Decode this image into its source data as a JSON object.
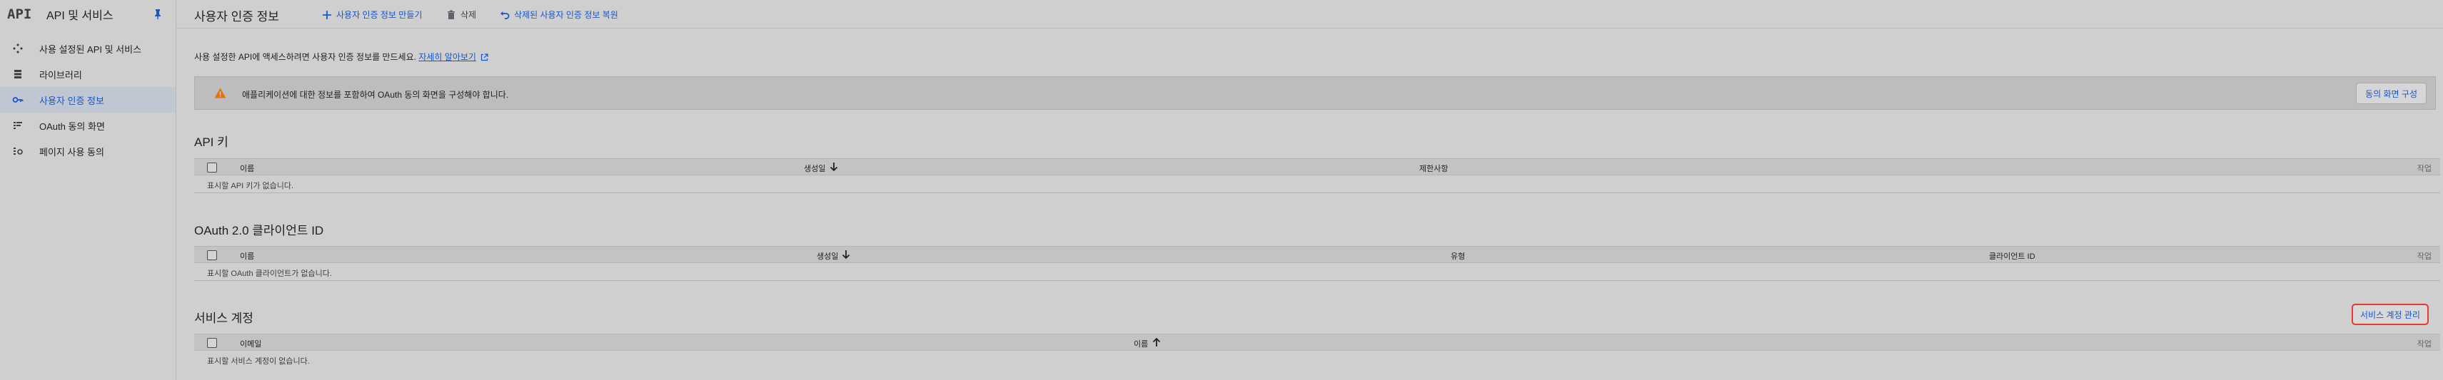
{
  "sidebar": {
    "logo": "API",
    "title": "API 및 서비스",
    "items": [
      {
        "label": "사용 설정된 API 및 서비스",
        "active": false
      },
      {
        "label": "라이브러리",
        "active": false
      },
      {
        "label": "사용자 인증 정보",
        "active": true
      },
      {
        "label": "OAuth 동의 화면",
        "active": false
      },
      {
        "label": "페이지 사용 동의",
        "active": false
      }
    ]
  },
  "header": {
    "title": "사용자 인증 정보",
    "create_label": "사용자 인증 정보 만들기",
    "delete_label": "삭제",
    "restore_label": "삭제된 사용자 인증 정보 복원"
  },
  "intro": {
    "text": "사용 설정한 API에 액세스하려면 사용자 인증 정보를 만드세요.",
    "link": "자세히 알아보기"
  },
  "banner": {
    "text": "애플리케이션에 대한 정보를 포함하여 OAuth 동의 화면을 구성해야 합니다.",
    "button": "동의 화면 구성"
  },
  "api_keys": {
    "title": "API 키",
    "columns": [
      "이름",
      "생성일",
      "제한사항",
      "작업"
    ],
    "empty": "표시할 API 키가 없습니다."
  },
  "oauth": {
    "title": "OAuth 2.0 클라이언트 ID",
    "columns": [
      "이름",
      "생성일",
      "유형",
      "클라이언트 ID",
      "작업"
    ],
    "empty": "표시할 OAuth 클라이언트가 없습니다."
  },
  "service_accounts": {
    "title": "서비스 계정",
    "manage_button": "서비스 계정 관리",
    "columns": [
      "이메일",
      "이름",
      "작업"
    ],
    "empty": "표시할 서비스 계정이 없습니다."
  },
  "colors": {
    "accent": "#1a56c4",
    "highlight_border": "#e53935",
    "warning": "#e8710a",
    "background": "#cfcfcf"
  }
}
